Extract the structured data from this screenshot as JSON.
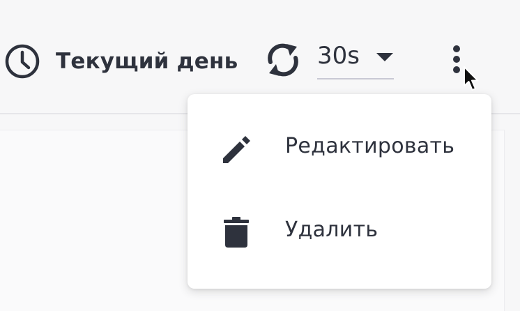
{
  "toolbar": {
    "time_range_label": "Текущий день",
    "time_range_icon": "clock-icon",
    "refresh_icon": "refresh-icon",
    "refresh_interval": "30s",
    "more_icon": "more-vertical-icon"
  },
  "menu": {
    "items": [
      {
        "label": "Редактировать",
        "icon": "pencil-icon"
      },
      {
        "label": "Удалить",
        "icon": "trash-icon"
      }
    ]
  },
  "colors": {
    "text": "#2e323d",
    "background": "#f7f7f8",
    "menu_background": "#ffffff",
    "underline": "#c9c9d4"
  }
}
